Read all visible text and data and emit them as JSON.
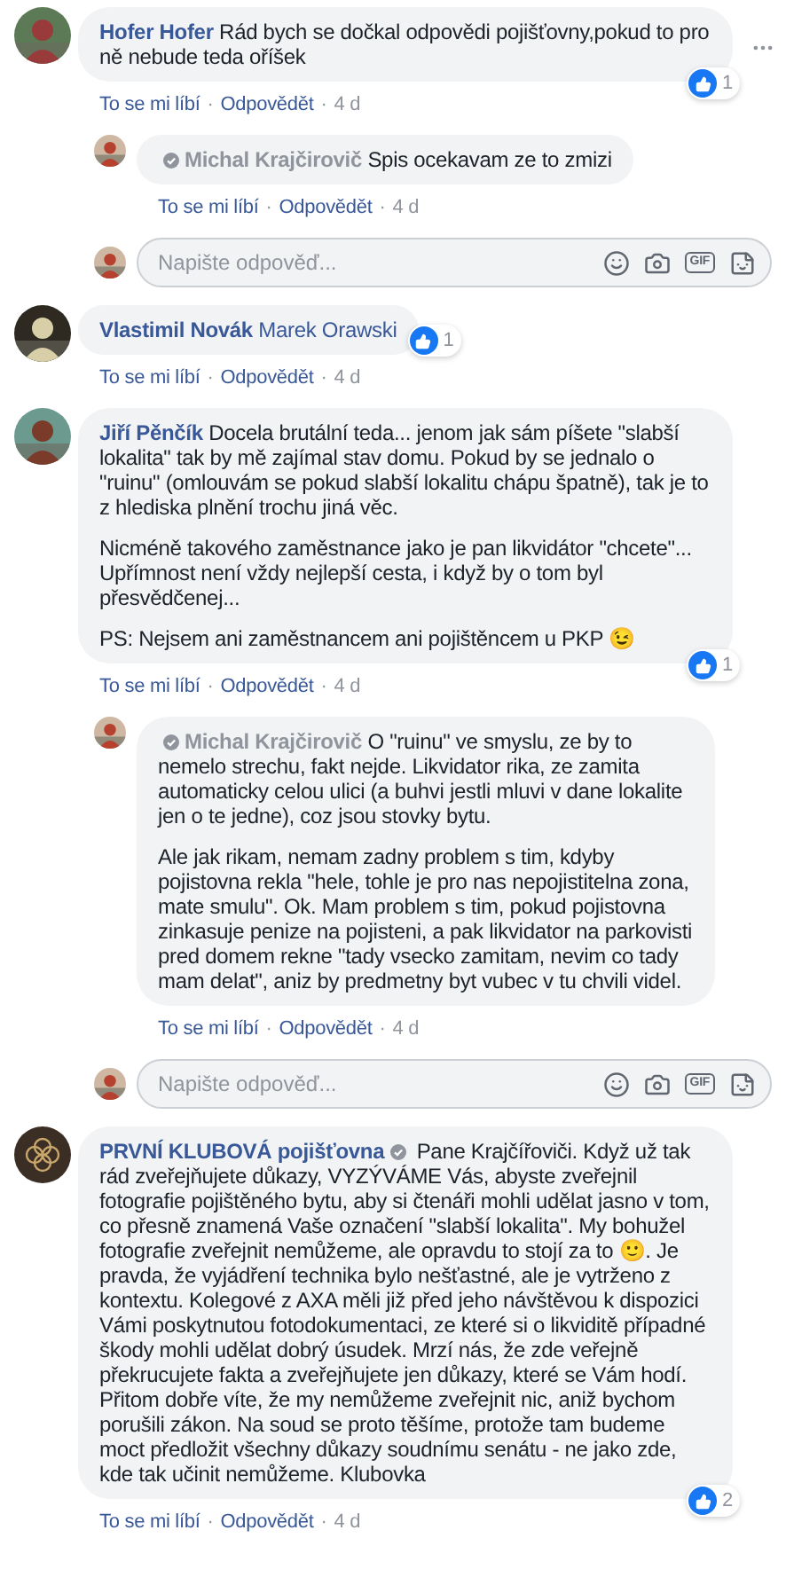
{
  "comments": [
    {
      "author": "Hofer Hofer",
      "author_muted": false,
      "badge_before": false,
      "badge_after": false,
      "paragraphs": [
        "Rád bych se dočkal odpovědi pojišťovny,pokud to pro ně nebude teda oříšek"
      ],
      "likes": "1",
      "menu": true,
      "actions": [
        {
          "kind": "link",
          "text": "To se mi líbí"
        },
        {
          "kind": "sep",
          "text": "·"
        },
        {
          "kind": "link",
          "text": "Odpovědět"
        },
        {
          "kind": "sep",
          "text": "·"
        },
        {
          "kind": "time",
          "text": "4 d"
        }
      ],
      "replies": [
        {
          "author": "Michal Krajčirovič",
          "author_muted": true,
          "badge_before": true,
          "badge_after": false,
          "paragraphs": [
            "Spis ocekavam ze to zmizi"
          ],
          "menu": false,
          "actions": [
            {
              "kind": "link",
              "text": "To se mi líbí"
            },
            {
              "kind": "sep",
              "text": "·"
            },
            {
              "kind": "link",
              "text": "Odpovědět"
            },
            {
              "kind": "sep",
              "text": "·"
            },
            {
              "kind": "time",
              "text": "4 d"
            }
          ]
        }
      ],
      "reply_box": {
        "placeholder": "Napište odpověď...",
        "gif_label": "GIF"
      }
    },
    {
      "author": "Vlastimil Novák",
      "author_muted": false,
      "badge_before": false,
      "badge_after": false,
      "mention": "Marek Orawski",
      "likes": "1",
      "menu": false,
      "actions": [
        {
          "kind": "link",
          "text": "To se mi líbí"
        },
        {
          "kind": "sep",
          "text": "·"
        },
        {
          "kind": "link",
          "text": "Odpovědět"
        },
        {
          "kind": "sep",
          "text": "·"
        },
        {
          "kind": "time",
          "text": "4 d"
        }
      ]
    },
    {
      "author": "Jiří Pěnčík",
      "author_muted": false,
      "badge_before": false,
      "badge_after": false,
      "paragraphs": [
        "Docela brutální teda... jenom jak sám píšete \"slabší lokalita\" tak by mě zajímal stav domu. Pokud by se jednalo o \"ruinu\" (omlouvám se pokud slabší lokalitu chápu špatně), tak je to z hlediska plnění trochu jiná věc.",
        "Nicméně takového zaměstnance jako je pan likvidátor \"chcete\"... Upřímnost není vždy nejlepší cesta, i když by o tom byl přesvědčenej...",
        "PS: Nejsem ani zaměstnancem ani pojištěncem u PKP 😉"
      ],
      "likes": "1",
      "menu": false,
      "actions": [
        {
          "kind": "link",
          "text": "To se mi líbí"
        },
        {
          "kind": "sep",
          "text": "·"
        },
        {
          "kind": "link",
          "text": "Odpovědět"
        },
        {
          "kind": "sep",
          "text": "·"
        },
        {
          "kind": "time",
          "text": "4 d"
        }
      ],
      "replies": [
        {
          "author": "Michal Krajčirovič",
          "author_muted": true,
          "badge_before": true,
          "badge_after": false,
          "paragraphs": [
            "O \"ruinu\" ve smyslu, ze by to nemelo strechu, fakt nejde. Likvidator rika, ze zamita automaticky celou ulici (a buhvi jestli mluvi v dane lokalite jen o te jedne), coz jsou stovky bytu.",
            "Ale jak rikam, nemam zadny problem s tim, kdyby pojistovna rekla \"hele, tohle je pro nas nepojistitelna zona, mate smulu\". Ok. Mam problem s tim, pokud pojistovna zinkasuje penize na pojisteni, a pak likvidator na parkovisti pred domem rekne \"tady vsecko zamitam, nevim co tady mam delat\", aniz by predmetny byt vubec v tu chvili videl."
          ],
          "menu": false,
          "actions": [
            {
              "kind": "link",
              "text": "To se mi líbí"
            },
            {
              "kind": "sep",
              "text": "·"
            },
            {
              "kind": "link",
              "text": "Odpovědět"
            },
            {
              "kind": "sep",
              "text": "·"
            },
            {
              "kind": "time",
              "text": "4 d"
            }
          ]
        }
      ],
      "reply_box": {
        "placeholder": "Napište odpověď...",
        "gif_label": "GIF"
      }
    },
    {
      "author": "PRVNÍ KLUBOVÁ pojišťovna",
      "author_muted": false,
      "badge_before": false,
      "badge_after": true,
      "paragraphs": [
        "Pane Krajčířoviči. Když už tak rád zveřejňujete důkazy, VYZÝVÁME Vás, abyste zveřejnil fotografie pojištěného bytu, aby si čtenáři mohli udělat jasno v tom, co přesně znamená Vaše označení \"slabší lokalita\". My bohužel fotografie zveřejnit nemůžeme, ale opravdu to stojí za to 🙂. Je pravda, že vyjádření technika bylo nešťastné, ale je vytrženo z kontextu. Kolegové z AXA měli již před jeho návštěvou k dispozici Vámi poskytnutou fotodokumentaci, ze které si o likviditě případné škody mohli udělat dobrý úsudek. Mrzí nás, že zde veřejně překrucujete fakta a zveřejňujete jen důkazy, které se Vám hodí. Přitom dobře víte, že my nemůžeme zveřejnit nic, aniž bychom porušili zákon. Na soud se proto těšíme, protože tam budeme moct předložit všechny důkazy soudnímu senátu - ne jako zde, kde tak učinit nemůžeme. Klubovka"
      ],
      "likes": "2",
      "menu": false,
      "actions": [
        {
          "kind": "link",
          "text": "To se mi líbí"
        },
        {
          "kind": "sep",
          "text": "·"
        },
        {
          "kind": "link",
          "text": "Odpovědět"
        },
        {
          "kind": "sep",
          "text": "·"
        },
        {
          "kind": "time",
          "text": "4 d"
        }
      ]
    }
  ]
}
